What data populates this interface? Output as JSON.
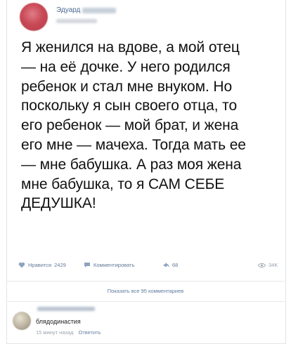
{
  "post": {
    "author_visible_name": "Эдуард",
    "text": "Я женился на вдове, а мой отец — на её дочке. У него родился ребенок и стал мне внуком. Но поскольку я сын своего отца, то его ребенок — мой брат, и жена его мне — мачеха. Тогда мать ее — мне бабушка. А раз моя жена мне бабушка, то я САМ СЕБЕ ДЕДУШКА!"
  },
  "actions": {
    "like_label": "Нравится",
    "like_count": "2429",
    "comment_label": "Комментировать",
    "share_count": "68",
    "views_count": "34K"
  },
  "comments": {
    "show_all_label": "Показать все 95 комментариев",
    "item": {
      "text": "блядодинастия",
      "time": "15 минут назад",
      "reply_label": "Ответить"
    }
  },
  "icons": [
    "heart-icon",
    "comment-icon",
    "share-icon",
    "eye-icon"
  ],
  "colors": {
    "link": "#4a6b95",
    "muted": "#9aa3ae",
    "text": "#111111"
  }
}
